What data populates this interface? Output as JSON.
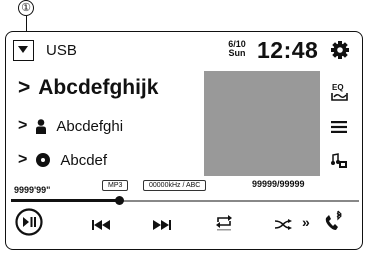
{
  "callout": {
    "number": "①"
  },
  "header": {
    "source_label": "USB",
    "date_top": "6/10",
    "date_bottom": "Sun",
    "time": "12:48"
  },
  "track": {
    "title": "Abcdefghijk",
    "artist": "Abcdefghi",
    "album": "Abcdef"
  },
  "info": {
    "format": "MP3",
    "quality": "00000kHz / ABC",
    "track_count": "99999/99999",
    "elapsed": "9999'99\""
  },
  "progress": {
    "fraction": 0.31
  },
  "colors": {
    "artwork": "#999999",
    "foreground": "#111111"
  },
  "icons": [
    "source-menu-icon",
    "settings-gear-icon",
    "eq-icon",
    "list-icon",
    "music-browse-icon",
    "artist-icon",
    "album-icon",
    "play-pause-icon",
    "previous-track-icon",
    "next-track-icon",
    "repeat-icon",
    "shuffle-icon",
    "more-icon",
    "phone-icon"
  ]
}
